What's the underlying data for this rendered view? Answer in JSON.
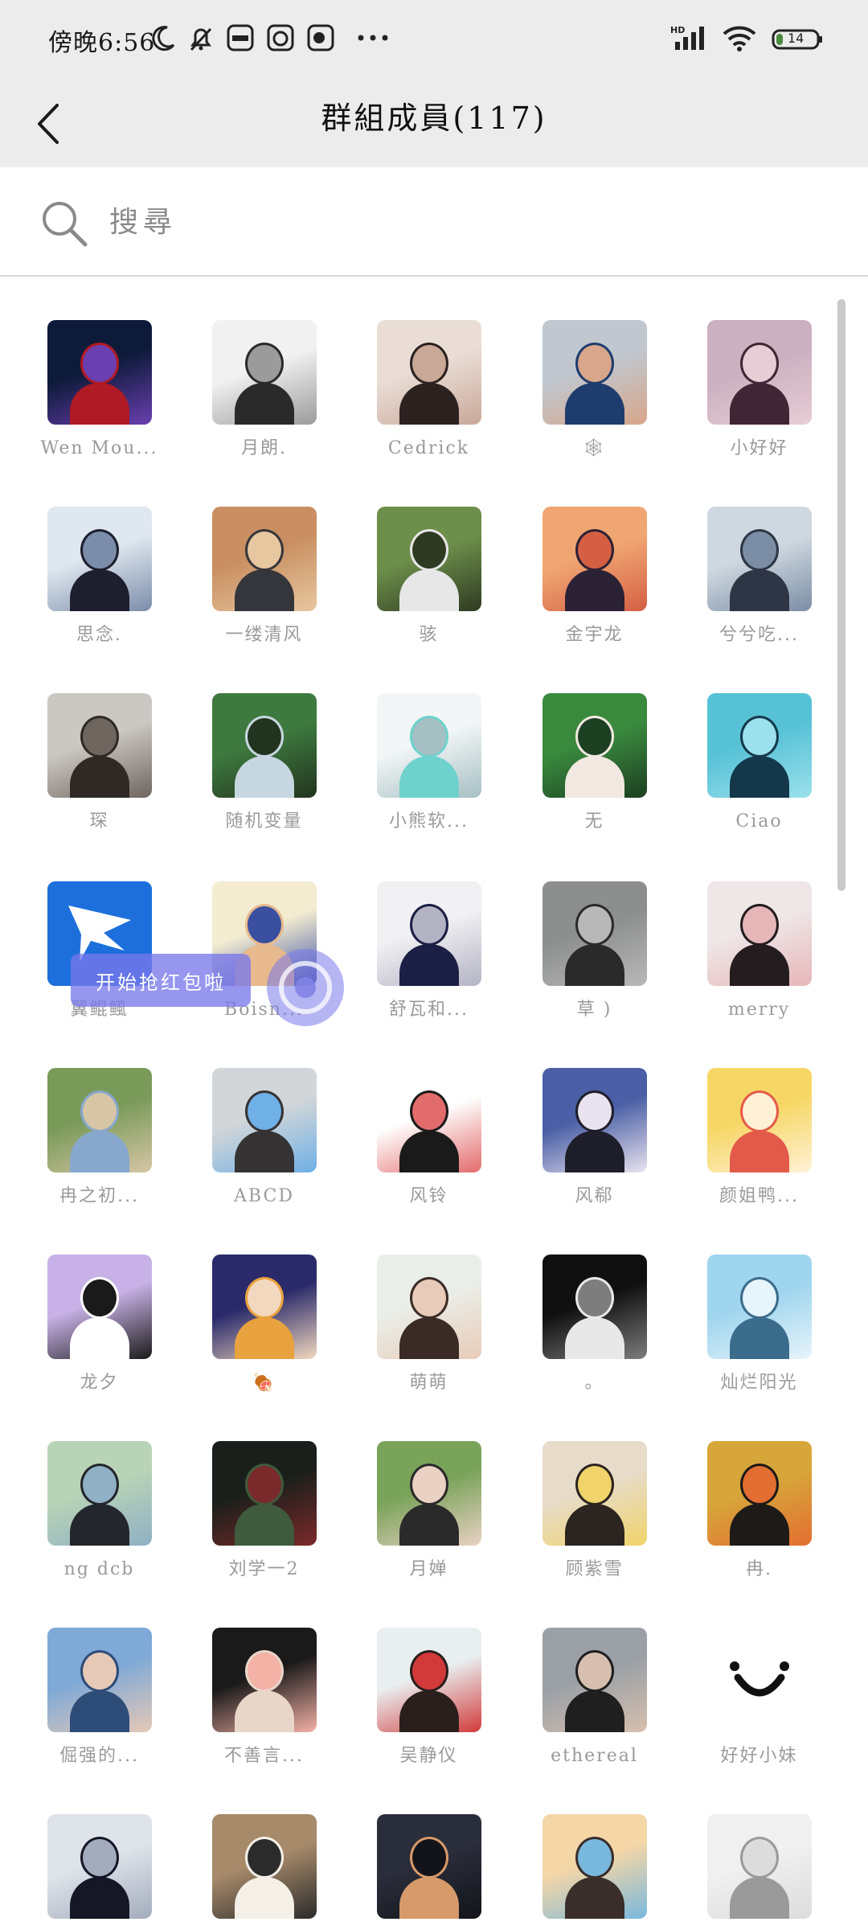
{
  "status_bar": {
    "time": "傍晚6:56",
    "battery": "14",
    "network": "HD"
  },
  "header": {
    "back_icon": "chevron-left-icon",
    "title": "群組成員(117)"
  },
  "search": {
    "placeholder": "搜尋",
    "value": ""
  },
  "floating": {
    "tip_text": "开始抢红包啦"
  },
  "members": [
    {
      "name": "Wen Mou...",
      "colors": [
        "#0d1a3a",
        "#b01a24",
        "#6a3fb0"
      ]
    },
    {
      "name": "月朗.",
      "colors": [
        "#f1f1f1",
        "#2a2a2a",
        "#9b9b9b"
      ]
    },
    {
      "name": "Cedrick",
      "colors": [
        "#e9ddd6",
        "#2b2220",
        "#c9a898"
      ]
    },
    {
      "name": "🕸",
      "colors": [
        "#c0c7cf",
        "#1e3d6e",
        "#d8a68a"
      ]
    },
    {
      "name": "小好好",
      "colors": [
        "#cbb0c0",
        "#3f2634",
        "#e7cdd5"
      ]
    },
    {
      "name": "思念.",
      "colors": [
        "#dfe7ef",
        "#1d1f2e",
        "#7c8daa"
      ]
    },
    {
      "name": "一缕清风",
      "colors": [
        "#c98f62",
        "#35363b",
        "#e7c79f"
      ]
    },
    {
      "name": "骇",
      "colors": [
        "#6d8f4b",
        "#e7e7e7",
        "#2f3a22"
      ]
    },
    {
      "name": "金宇龙",
      "colors": [
        "#f0a673",
        "#2b2135",
        "#d45f43"
      ]
    },
    {
      "name": "兮兮吃...",
      "colors": [
        "#cfd8e0",
        "#2e3545",
        "#7b8ea5"
      ]
    },
    {
      "name": "琛",
      "colors": [
        "#cbc7c3",
        "#2f2925",
        "#6f655f"
      ]
    },
    {
      "name": "随机变量",
      "colors": [
        "#3e7a3f",
        "#c7d7e1",
        "#22331f"
      ]
    },
    {
      "name": "小熊软...",
      "colors": [
        "#f2f6f6",
        "#6fd1cc",
        "#a6bfc3"
      ]
    },
    {
      "name": "无",
      "colors": [
        "#3a8a3e",
        "#f1e9e1",
        "#1d3f22"
      ]
    },
    {
      "name": "Ciao",
      "colors": [
        "#57c2d6",
        "#14384a",
        "#9be0ec"
      ]
    },
    {
      "name": "翼鲲鲺",
      "colors": [
        "#1d6fdc",
        "#ffffff",
        "#1d6fdc"
      ]
    },
    {
      "name": "Boisn...",
      "colors": [
        "#f3ecd1",
        "#e7b98c",
        "#3a4fa0"
      ]
    },
    {
      "name": "舒瓦和...",
      "colors": [
        "#f1f0f3",
        "#1b1f44",
        "#b3b3c4"
      ]
    },
    {
      "name": "草 )",
      "colors": [
        "#8d8e8e",
        "#2a2a2a",
        "#b8b8b8"
      ]
    },
    {
      "name": "merry",
      "colors": [
        "#efe6e7",
        "#241c1e",
        "#e6b6b8"
      ]
    },
    {
      "name": "冉之初...",
      "colors": [
        "#7a9a5a",
        "#87a7cc",
        "#d6c6a5"
      ]
    },
    {
      "name": "ABCD",
      "colors": [
        "#d2d6d8",
        "#353333",
        "#6fb0e6"
      ]
    },
    {
      "name": "风铃",
      "colors": [
        "#ffffff",
        "#1a1a1a",
        "#e26b6b"
      ]
    },
    {
      "name": "风郗",
      "colors": [
        "#4a5fa5",
        "#1e1e2a",
        "#e9e3ef"
      ]
    },
    {
      "name": "颜姐鸭...",
      "colors": [
        "#f6d765",
        "#e45a4a",
        "#fff1d6"
      ]
    },
    {
      "name": "龙夕",
      "colors": [
        "#c8b1e6",
        "#ffffff",
        "#1a1a1a"
      ]
    },
    {
      "name": "🍖",
      "colors": [
        "#2a2a6a",
        "#e8a23e",
        "#f2d8bf"
      ]
    },
    {
      "name": "萌萌",
      "colors": [
        "#eaeee8",
        "#3a2b26",
        "#e8cbb8"
      ]
    },
    {
      "name": "。",
      "colors": [
        "#101010",
        "#e8e8e8",
        "#7d7d7d"
      ]
    },
    {
      "name": "灿烂阳光",
      "colors": [
        "#9fd5ee",
        "#3c6c8c",
        "#e7f4fb"
      ]
    },
    {
      "name": "ng dcb",
      "colors": [
        "#b9d3b6",
        "#23262c",
        "#8fb0c5"
      ]
    },
    {
      "name": "刘学一2",
      "colors": [
        "#1b1f1b",
        "#3f5a3c",
        "#7a2a2a"
      ]
    },
    {
      "name": "月婵",
      "colors": [
        "#7aa35a",
        "#2a2a2a",
        "#e9d1c4"
      ]
    },
    {
      "name": "顾紫雪",
      "colors": [
        "#e7dcc9",
        "#2b2420",
        "#f0d36a"
      ]
    },
    {
      "name": "冉.",
      "colors": [
        "#d7a63a",
        "#1d1a17",
        "#e36e31"
      ]
    },
    {
      "name": "倔强的...",
      "colors": [
        "#7fa9d6",
        "#2d4c77",
        "#e6c9b7"
      ]
    },
    {
      "name": "不善言...",
      "colors": [
        "#1a1a1a",
        "#e8d6c9",
        "#f4b1a6"
      ]
    },
    {
      "name": "吴静仪",
      "colors": [
        "#e9eef0",
        "#2a1f1d",
        "#d23a3a"
      ]
    },
    {
      "name": "ethereal",
      "colors": [
        "#9aa0a6",
        "#1f1f1f",
        "#d6bfae"
      ]
    },
    {
      "name": "好好小妹",
      "colors": [
        "#ffffff",
        "#111111",
        "#ffffff"
      ]
    },
    {
      "name": "",
      "colors": [
        "#dfe4ea",
        "#151726",
        "#a3acbd"
      ]
    },
    {
      "name": "",
      "colors": [
        "#a78a6a",
        "#f4efe7",
        "#2b2b2b"
      ]
    },
    {
      "name": "",
      "colors": [
        "#2a2d3a",
        "#d79a6a",
        "#13141a"
      ]
    },
    {
      "name": "",
      "colors": [
        "#f4d6a7",
        "#3a2e2b",
        "#79b8dd"
      ]
    },
    {
      "name": "",
      "colors": [
        "#f0f0f0",
        "#9a9a9a",
        "#dcdcdc"
      ]
    }
  ]
}
